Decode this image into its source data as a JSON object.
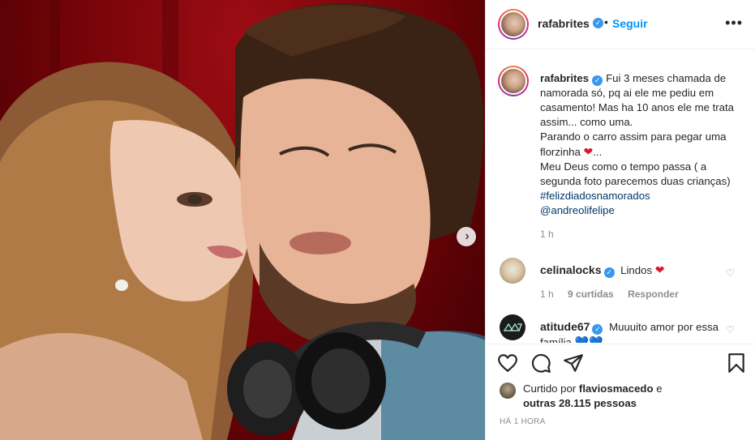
{
  "post": {
    "username": "rafabrites",
    "follow_label": "Seguir",
    "more_icon": "more-icon",
    "separator": "•"
  },
  "caption": {
    "username": "rafabrites",
    "line1": "Fui 3 meses chamada de namorada só, pq ai ele me pediu em casamento! Mas ha 10 anos ele me trata assim... como uma.",
    "line2": "Parando o carro assim para pegar uma florzinha",
    "line2_end": "...",
    "line3": "Meu Deus como o tempo passa ( a segunda foto parecemos duas crianças)",
    "hashtag": "#felizdiadosnamorados",
    "mention": "@andreolifelipe",
    "time": "1 h"
  },
  "comments": [
    {
      "username": "celinalocks",
      "text": "Lindos",
      "time": "1 h",
      "likes": "9 curtidas",
      "reply_label": "Responder"
    },
    {
      "username": "atitude67",
      "text": "Muuuito amor por essa família"
    }
  ],
  "likes": {
    "prefix": "Curtido por",
    "user": "flaviosmacedo",
    "conj": "e",
    "others": "outras 28.115 pessoas"
  },
  "posted_ago": "HÁ 1 HORA",
  "colors": {
    "link": "#0095f6",
    "verified": "#3897f0",
    "heart": "#e0152f",
    "muted": "#8e8e8e"
  }
}
